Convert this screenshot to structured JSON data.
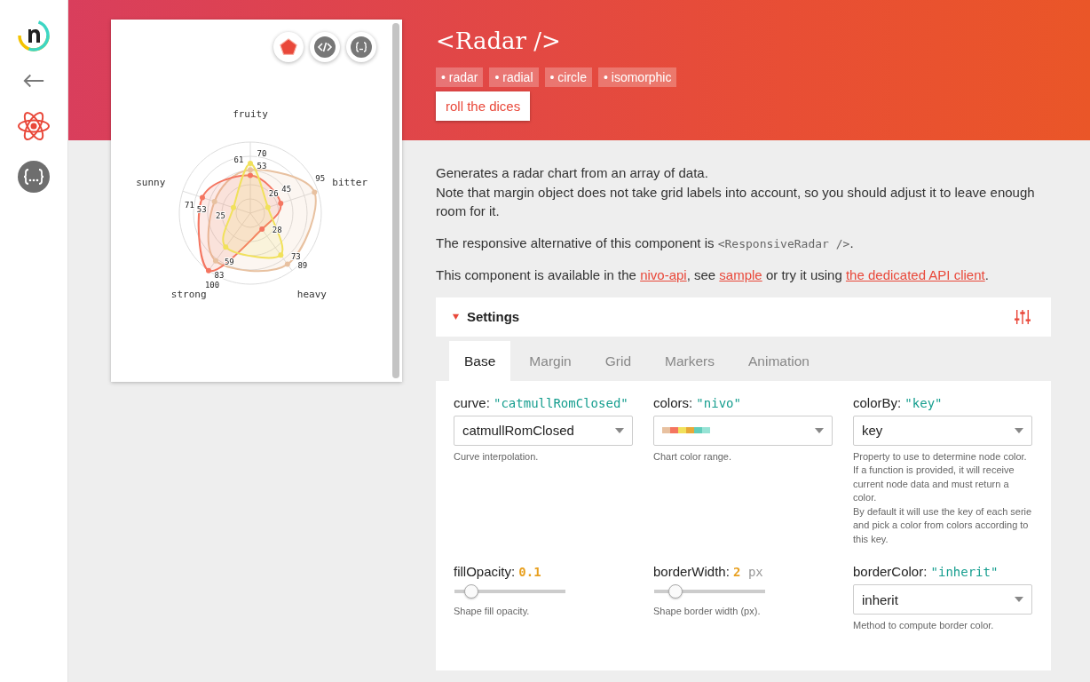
{
  "sidebar": {
    "items": [
      {
        "kind": "logo",
        "selected": false
      },
      {
        "kind": "back",
        "selected": false
      },
      {
        "kind": "react",
        "selected": true
      },
      {
        "kind": "api",
        "selected": false
      }
    ]
  },
  "preview": {
    "buttons": [
      {
        "kind": "chart",
        "selected": true
      },
      {
        "kind": "code",
        "selected": false
      },
      {
        "kind": "data",
        "selected": false
      }
    ],
    "radar": {
      "axes": [
        "fruity",
        "bitter",
        "heavy",
        "strong",
        "sunny"
      ],
      "series": [
        {
          "color": "#e8c1a0",
          "values": [
            "61",
            "95",
            "89",
            "83",
            "53"
          ]
        },
        {
          "color": "#f47560",
          "values": [
            "53",
            "45",
            "28",
            "100",
            "71"
          ]
        },
        {
          "color": "#f1e15b",
          "values": [
            "70",
            "26",
            "73",
            "59",
            "25"
          ]
        }
      ]
    }
  },
  "header": {
    "title": "<Radar />",
    "tags": [
      "• radar",
      "• radial",
      "• circle",
      "• isomorphic"
    ],
    "button": "roll the dices"
  },
  "description": {
    "paragraphs": [
      [
        {
          "kind": "text",
          "text": "Generates a radar chart from an array of data."
        },
        {
          "kind": "break"
        },
        {
          "kind": "text",
          "text": "Note that margin object does not take grid labels into account,  so you should adjust it to leave enough room for it."
        }
      ],
      [
        {
          "kind": "text",
          "text": "The responsive alternative of this component is "
        },
        {
          "kind": "code",
          "text": "<ResponsiveRadar />"
        },
        {
          "kind": "text",
          "text": "."
        }
      ],
      [
        {
          "kind": "text",
          "text": "This component is available in the "
        },
        {
          "kind": "link",
          "text": "nivo-api"
        },
        {
          "kind": "text",
          "text": ", see "
        },
        {
          "kind": "link",
          "text": "sample"
        },
        {
          "kind": "text",
          "text": " or try it using "
        },
        {
          "kind": "link",
          "text": "the dedicated API client"
        },
        {
          "kind": "text",
          "text": "."
        }
      ]
    ]
  },
  "settings": {
    "title": "Settings",
    "expanded": true,
    "tabs": [
      {
        "label": "Base",
        "selected": true
      },
      {
        "label": "Margin",
        "selected": false
      },
      {
        "label": "Grid",
        "selected": false
      },
      {
        "label": "Markers",
        "selected": false
      },
      {
        "label": "Animation",
        "selected": false
      }
    ],
    "controls": [
      {
        "kind": "select",
        "name": "curve:",
        "value": "\"catmullRomClosed\"",
        "numeric": false,
        "field": "catmullRomClosed",
        "help": [
          "Curve interpolation."
        ]
      },
      {
        "kind": "colors",
        "name": "colors:",
        "value": "\"nivo\"",
        "numeric": false,
        "swatches": [
          {
            "color": "#e8c1a0"
          },
          {
            "color": "#f47560"
          },
          {
            "color": "#f1e15b"
          },
          {
            "color": "#e8a838"
          },
          {
            "color": "#61cdbb"
          },
          {
            "color": "#97e3d5"
          }
        ],
        "help": [
          "Chart color range."
        ]
      },
      {
        "kind": "select",
        "name": "colorBy:",
        "value": "\"key\"",
        "numeric": false,
        "field": "key",
        "help": [
          "Property to use to determine node color.",
          "If a function is provided, it will receive current node data and must return a color.",
          "By default it will use the key of each serie and pick a color from colors according to this key."
        ]
      },
      {
        "kind": "slider",
        "name": "fillOpacity:",
        "value": "0.1",
        "numeric": true,
        "level": 0.1,
        "help": [
          "Shape fill opacity."
        ]
      },
      {
        "kind": "slider",
        "name": "borderWidth:",
        "value": "2",
        "numeric": true,
        "unit": "px",
        "level": 0.15,
        "help": [
          "Shape border width (px)."
        ]
      },
      {
        "kind": "select",
        "name": "borderColor:",
        "value": "\"inherit\"",
        "numeric": false,
        "field": "inherit",
        "help": [
          "Method to compute border color."
        ]
      }
    ]
  }
}
